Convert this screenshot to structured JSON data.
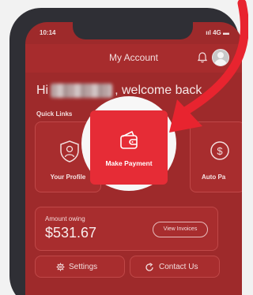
{
  "status_bar": {
    "time": "10:14",
    "right": "ııl 4G ▬"
  },
  "header": {
    "title": "My Account"
  },
  "greeting": {
    "hi": "Hi",
    "suffix": ", welcome back"
  },
  "quick_links": {
    "label": "Quick Links",
    "items": [
      {
        "label": "Your Profile",
        "icon": "shield-person-icon"
      },
      {
        "label": "Make Payment",
        "icon": "wallet-icon"
      },
      {
        "label": "Auto Pa",
        "icon": "dollar-circle-icon"
      }
    ]
  },
  "amount": {
    "label": "Amount owing",
    "value": "$531.67",
    "view_invoices": "View Invoices"
  },
  "actions": {
    "settings": "Settings",
    "contact": "Contact Us"
  },
  "colors": {
    "brand_red": "#a72c2d",
    "highlight_red": "#e62c36",
    "arrow": "#e8242f"
  }
}
